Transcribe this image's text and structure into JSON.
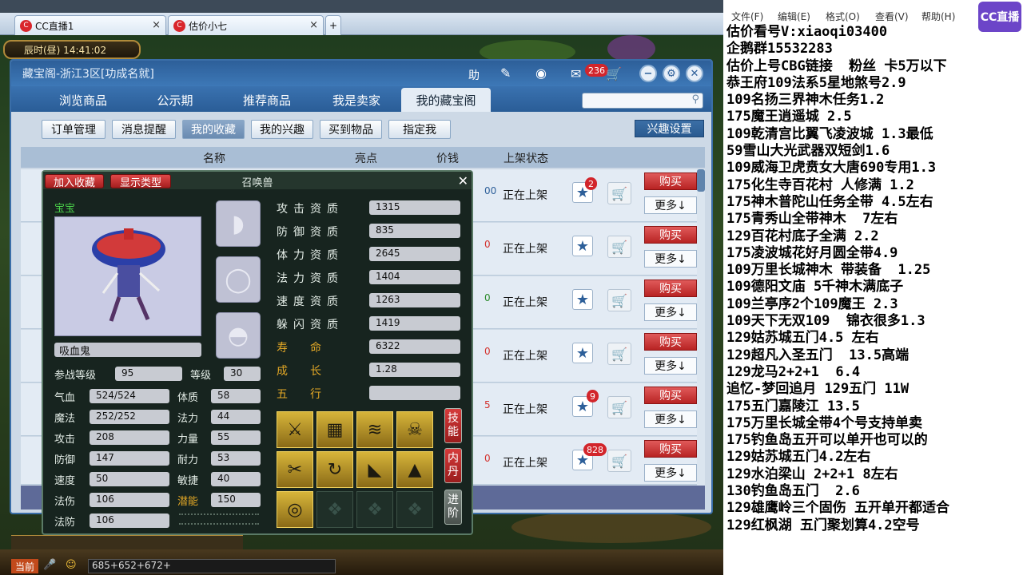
{
  "browser": {
    "tabs": [
      {
        "label": "CC直播1"
      },
      {
        "label": "估价小七"
      }
    ],
    "new_tab": "+"
  },
  "game_clock": "辰时(昼) 14:41:02",
  "window": {
    "title": "藏宝阁-浙江3区[功成名就]",
    "help": "助",
    "msg_badge": "236",
    "nav_tabs": [
      "浏览商品",
      "公示期",
      "推荐商品",
      "我是卖家",
      "我的藏宝阁"
    ],
    "active_nav": "我的藏宝阁",
    "sub_tabs": [
      "订单管理",
      "消息提醒",
      "我的收藏",
      "我的兴趣",
      "买到物品",
      "指定我"
    ],
    "active_sub": "我的收藏",
    "interest_button": "兴趣设置",
    "table_headers": [
      "名称",
      "亮点",
      "价钱",
      "上架状态"
    ],
    "rows": [
      {
        "mark": "00",
        "status": "正在上架",
        "badge": "2",
        "buy": "购买",
        "more": "更多↓"
      },
      {
        "mark": "0",
        "status": "正在上架",
        "badge": "",
        "buy": "购买",
        "more": "更多↓"
      },
      {
        "mark": "0",
        "status": "正在上架",
        "badge": "",
        "buy": "购买",
        "more": "更多↓"
      },
      {
        "mark": "0",
        "status": "正在上架",
        "badge": "",
        "buy": "购买",
        "more": "更多↓"
      },
      {
        "mark": "5",
        "status": "正在上架",
        "badge": "9",
        "buy": "购买",
        "more": "更多↓"
      },
      {
        "mark": "0",
        "status": "正在上架",
        "badge": "828",
        "buy": "购买",
        "more": "更多↓"
      }
    ]
  },
  "pet": {
    "title": "召唤兽",
    "add_fav": "加入收藏",
    "show_type": "显示类型",
    "baby_label": "宝宝",
    "name": "吸血鬼",
    "left_stats": [
      {
        "label": "参战等级",
        "value": "95"
      },
      {
        "label": "等级",
        "value": "30"
      }
    ],
    "stats": [
      {
        "label": "气血",
        "value": "524/524",
        "label2": "体质",
        "value2": "58"
      },
      {
        "label": "魔法",
        "value": "252/252",
        "label2": "法力",
        "value2": "44"
      },
      {
        "label": "攻击",
        "value": "208",
        "label2": "力量",
        "value2": "55"
      },
      {
        "label": "防御",
        "value": "147",
        "label2": "耐力",
        "value2": "53"
      },
      {
        "label": "速度",
        "value": "50",
        "label2": "敏捷",
        "value2": "40"
      },
      {
        "label": "法伤",
        "value": "106",
        "label2": "潜能",
        "value2": "150"
      },
      {
        "label": "法防",
        "value": "106"
      }
    ],
    "aptitudes": [
      {
        "label": "攻击资质",
        "value": "1315"
      },
      {
        "label": "防御资质",
        "value": "835"
      },
      {
        "label": "体力资质",
        "value": "2645"
      },
      {
        "label": "法力资质",
        "value": "1404"
      },
      {
        "label": "速度资质",
        "value": "1263"
      },
      {
        "label": "躲闪资质",
        "value": "1419"
      },
      {
        "label": "寿　　命",
        "value": "6322"
      },
      {
        "label": "成　　长",
        "value": "1.28"
      },
      {
        "label": "五　　行",
        "value": ""
      }
    ],
    "side_buttons": [
      "技能",
      "内丹",
      "进阶"
    ]
  },
  "hud": {
    "current": "当前",
    "chat_text": "685+652+672+"
  },
  "notepad": {
    "menu": [
      "文件(F)",
      "编辑(E)",
      "格式(O)",
      "查看(V)",
      "帮助(H)"
    ],
    "lines": [
      "估价看号V:xiaoqi03400",
      "企鹅群15532283",
      "估价上号CBG链接  粉丝 卡5万以下",
      "恭王府109法系5星地煞号2.9",
      "109名扬三界神木任务1.2",
      "175魔王逍遥城 2.5",
      "109乾清宫比翼飞凌波城 1.3最低",
      "59雪山大光武器双短剑1.6",
      "109威海卫虎贲女大唐690专用1.3",
      "175化生寺百花村 人修满 1.2",
      "175神木普陀山任务全带 4.5左右",
      "175青秀山全带神木  7左右",
      "129百花村底子全满 2.2",
      "175凌波城花好月圆全带4.9",
      "109万里长城神木 带装备  1.25",
      "109德阳文庙 5千神木满底子",
      "109兰亭序2个109魔王 2.3",
      "109天下无双109  锦衣很多1.3",
      "129姑苏城五门4.5 左右",
      "129超凡入圣五门  13.5高端",
      "129龙马2+2+1  6.4",
      "追忆-梦回追月 129五门 11W",
      "175五门嘉陵江 13.5",
      "175万里长城全带4个号支持单卖",
      "175钓鱼岛五开可以单开也可以的",
      "129姑苏城五门4.2左右",
      "129水泊梁山 2+2+1 8左右",
      "130钓鱼岛五门  2.6",
      "129雄鹰岭三个固伤 五开单开都适合",
      "129红枫湖 五门聚划算4.2空号"
    ]
  },
  "logo": "CC直播",
  "colors": {
    "accent": "#2d5f99",
    "buy": "#c62f2f",
    "gold": "#e3a826",
    "baby": "#4ad24a"
  }
}
